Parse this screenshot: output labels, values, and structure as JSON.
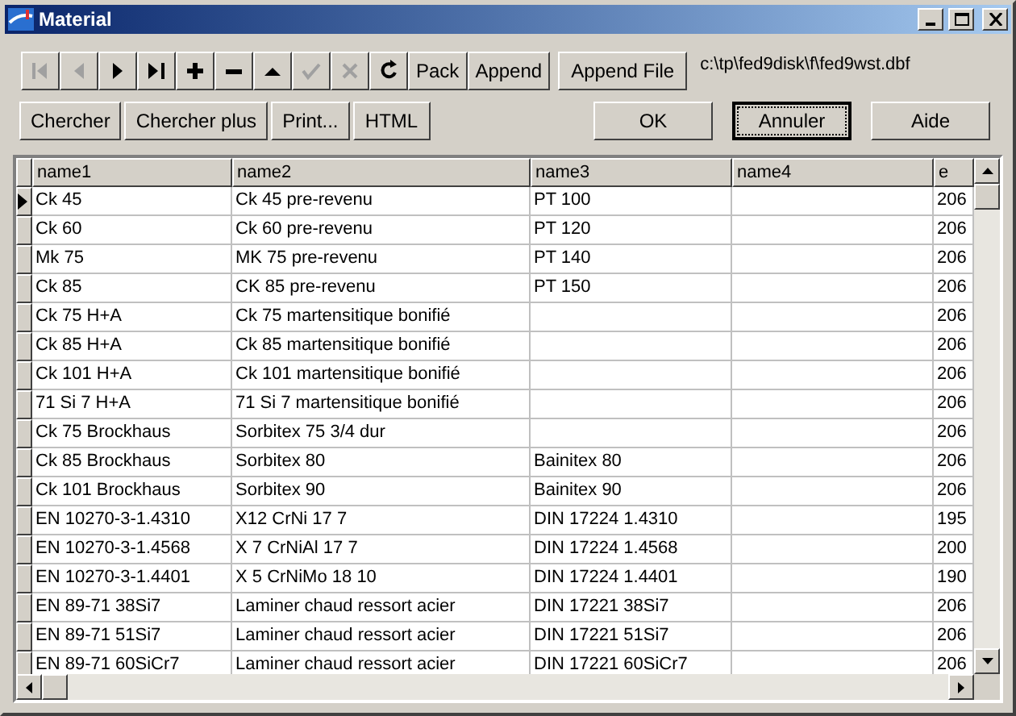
{
  "window": {
    "title": "Material"
  },
  "nav_buttons": [
    {
      "kind": "first",
      "disabled": true
    },
    {
      "kind": "prior",
      "disabled": true
    },
    {
      "kind": "next",
      "disabled": false
    },
    {
      "kind": "last",
      "disabled": false
    },
    {
      "kind": "insert",
      "disabled": false
    },
    {
      "kind": "delete",
      "disabled": false
    },
    {
      "kind": "edit",
      "disabled": false
    },
    {
      "kind": "post",
      "disabled": true
    },
    {
      "kind": "cancel",
      "disabled": true
    },
    {
      "kind": "refresh",
      "disabled": false
    }
  ],
  "text_buttons": [
    "Pack",
    "Append"
  ],
  "append_file_button": "Append File",
  "file_path": "c:\\tp\\fed9disk\\f\\fed9wst.dbf",
  "left_buttons": [
    "Chercher",
    "Chercher plus",
    "Print...",
    "HTML"
  ],
  "right_buttons": [
    {
      "label": "OK",
      "focused": false
    },
    {
      "label": "Annuler",
      "focused": true
    },
    {
      "label": "Aide",
      "focused": false
    }
  ],
  "table": {
    "columns": [
      "name1",
      "name2",
      "name3",
      "name4",
      "e"
    ],
    "rows": [
      {
        "selected": true,
        "cells": [
          "Ck 45",
          "Ck 45 pre-revenu",
          "PT 100",
          "",
          "206"
        ]
      },
      {
        "selected": false,
        "cells": [
          "Ck 60",
          "Ck 60 pre-revenu",
          "PT 120",
          "",
          "206"
        ]
      },
      {
        "selected": false,
        "cells": [
          "Mk 75",
          "MK 75 pre-revenu",
          "PT 140",
          "",
          "206"
        ]
      },
      {
        "selected": false,
        "cells": [
          "Ck 85",
          "CK 85 pre-revenu",
          "PT 150",
          "",
          "206"
        ]
      },
      {
        "selected": false,
        "cells": [
          "Ck 75 H+A",
          "Ck 75 martensitique bonifié",
          "",
          "",
          "206"
        ]
      },
      {
        "selected": false,
        "cells": [
          "Ck 85 H+A",
          "Ck 85 martensitique bonifié",
          "",
          "",
          "206"
        ]
      },
      {
        "selected": false,
        "cells": [
          "Ck 101 H+A",
          "Ck 101 martensitique bonifié",
          "",
          "",
          "206"
        ]
      },
      {
        "selected": false,
        "cells": [
          "71 Si 7 H+A",
          "71 Si 7 martensitique bonifié",
          "",
          "",
          "206"
        ]
      },
      {
        "selected": false,
        "cells": [
          "Ck 75 Brockhaus",
          "Sorbitex 75  3/4 dur",
          "",
          "",
          "206"
        ]
      },
      {
        "selected": false,
        "cells": [
          "Ck 85 Brockhaus",
          "Sorbitex 80",
          "Bainitex 80",
          "",
          "206"
        ]
      },
      {
        "selected": false,
        "cells": [
          "Ck 101 Brockhaus",
          "Sorbitex 90",
          "Bainitex 90",
          "",
          "206"
        ]
      },
      {
        "selected": false,
        "cells": [
          "EN 10270-3-1.4310",
          "X12 CrNi 17 7",
          "DIN 17224 1.4310",
          "",
          "195"
        ]
      },
      {
        "selected": false,
        "cells": [
          "EN 10270-3-1.4568",
          "X 7 CrNiAl 17 7",
          "DIN 17224 1.4568",
          "",
          "200"
        ]
      },
      {
        "selected": false,
        "cells": [
          "EN 10270-3-1.4401",
          "X 5 CrNiMo 18 10",
          "DIN 17224 1.4401",
          "",
          "190"
        ]
      },
      {
        "selected": false,
        "cells": [
          "EN 89-71 38Si7",
          "Laminer chaud ressort acier",
          "DIN 17221 38Si7",
          "",
          "206"
        ]
      },
      {
        "selected": false,
        "cells": [
          "EN 89-71 51Si7",
          "Laminer chaud ressort acier",
          "DIN 17221 51Si7",
          "",
          "206"
        ]
      },
      {
        "selected": false,
        "cells": [
          "EN 89-71 60SiCr7",
          "Laminer chaud ressort  acier",
          "DIN 17221 60SiCr7",
          "",
          "206"
        ]
      }
    ]
  }
}
